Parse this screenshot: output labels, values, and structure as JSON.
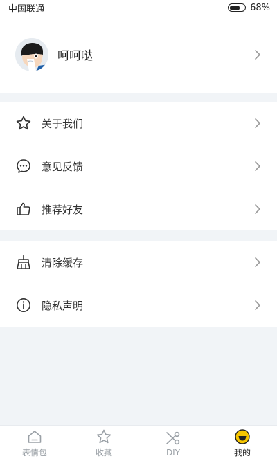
{
  "status_bar": {
    "carrier": "中国联通",
    "battery_percent": "68%",
    "battery_level": 0.68
  },
  "profile": {
    "name": "呵呵哒",
    "avatar_icon": "cartoon-boy-avatar"
  },
  "menu_groups": [
    [
      {
        "label": "关于我们",
        "icon": "star-icon"
      },
      {
        "label": "意见反馈",
        "icon": "chat-bubble-icon"
      },
      {
        "label": "推荐好友",
        "icon": "thumbs-up-icon"
      }
    ],
    [
      {
        "label": "清除缓存",
        "icon": "broom-icon"
      },
      {
        "label": "隐私声明",
        "icon": "info-icon"
      }
    ]
  ],
  "tabbar": {
    "items": [
      {
        "label": "表情包",
        "icon": "home-icon",
        "active": false
      },
      {
        "label": "收藏",
        "icon": "star-icon",
        "active": false
      },
      {
        "label": "DIY",
        "icon": "scissors-icon",
        "active": false
      },
      {
        "label": "我的",
        "icon": "smiley-icon",
        "active": true
      }
    ]
  },
  "colors": {
    "accent": "#f7c600",
    "background": "#f1f4f7",
    "inactive": "#9aa0a6"
  }
}
